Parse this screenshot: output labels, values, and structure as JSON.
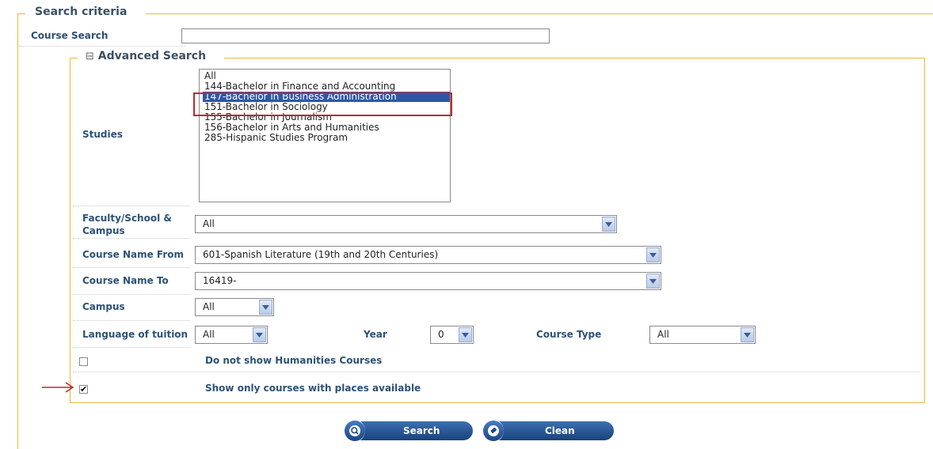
{
  "search_criteria": {
    "legend": "Search criteria",
    "course_search_label": "Course Search",
    "course_search_value": ""
  },
  "advanced": {
    "toggle_glyph": "⊟",
    "legend": "Advanced Search",
    "studies_label": "Studies",
    "studies_options": [
      "All",
      "144-Bachelor in Finance and Accounting",
      "147-Bachelor in Business Administration",
      "151-Bachelor in Sociology",
      "155-Bachelor in Journalism",
      "156-Bachelor in Arts and Humanities",
      "285-Hispanic Studies Program"
    ],
    "studies_selected_index": 2,
    "faculty_label_line1": "Faculty/School &",
    "faculty_label_line2": "Campus",
    "faculty_value": "All",
    "course_from_label": "Course Name From",
    "course_from_value": "601-Spanish Literature (19th and 20th Centuries)",
    "course_to_label": "Course Name To",
    "course_to_value": "16419-",
    "campus_label": "Campus",
    "campus_value": "All",
    "language_label": "Language of tuition",
    "language_value": "All",
    "year_label": "Year",
    "year_value": "0",
    "course_type_label": "Course Type",
    "course_type_value": "All",
    "no_humanities_label": "Do not show Humanities Courses",
    "no_humanities_checked": false,
    "places_label": "Show only courses with places available",
    "places_checked": true
  },
  "buttons": {
    "search_label": "Search",
    "clean_label": "Clean"
  },
  "colors": {
    "fieldset_border": "#e8b93a",
    "label_text": "#2c5278",
    "selection_bg": "#2f57a6",
    "highlight_box": "#c0282d",
    "arrow": "#c0282d",
    "button_bg": "#1d4a86"
  }
}
